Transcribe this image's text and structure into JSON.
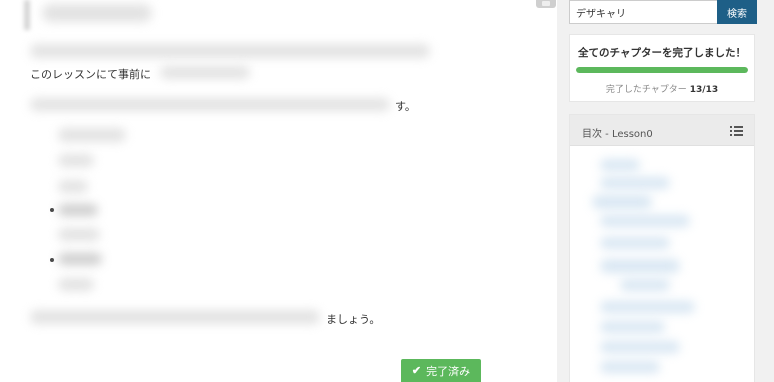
{
  "main": {
    "text_line1_prefix": "このレッスンにて事前に",
    "text_line2_suffix": "す。",
    "text_last_suffix": "ましょう。",
    "complete_button": {
      "label": "完了済み",
      "icon": "check-icon"
    }
  },
  "sidebar": {
    "search": {
      "value": "デザキャリ",
      "button_label": "検索"
    },
    "progress": {
      "title": "全てのチャプターを完了しました！",
      "label": "完了したチャプター",
      "count": "13/13",
      "fraction": 1.0,
      "color": "#5cb85c"
    },
    "toc": {
      "title": "目次 - Lesson0",
      "icon": "list-icon"
    }
  },
  "colors": {
    "accent": "#1e5f87",
    "success": "#5cb85c",
    "sidebar_bg": "#f1f1f1"
  }
}
